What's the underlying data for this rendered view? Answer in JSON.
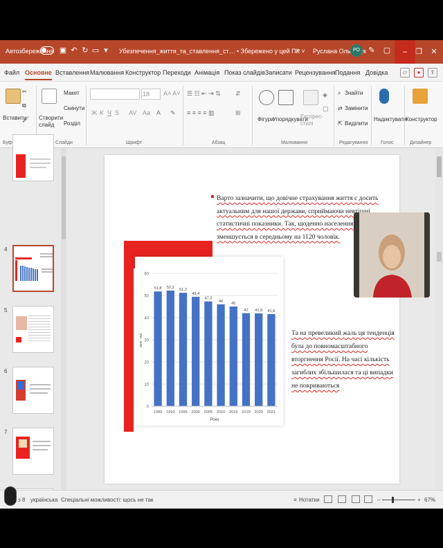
{
  "titlebar": {
    "autosave_label": "Автозбереження",
    "doc_title": "Убезпечення_життя_та_ставлення_студента_до_ризику_ст...",
    "save_status": "• Збережено у цей ПК ˅",
    "user_name": "Руслана Ольльчук",
    "user_initials": "РО"
  },
  "tabs": [
    "Файл",
    "Основне",
    "Вставлення",
    "Малювання",
    "Конструктор",
    "Переходи",
    "Анімація",
    "Показ слайдів",
    "Записати",
    "Рецензування",
    "Подання",
    "Довідка"
  ],
  "active_tab": "Основне",
  "ribbon": {
    "clipboard": {
      "paste": "Вставити",
      "label": "Буфер обміну"
    },
    "slides": {
      "new_slide": "Створити слайд",
      "layout": "Макет",
      "reset": "Скинути",
      "section": "Розділ",
      "label": "Слайди"
    },
    "font": {
      "size": "18",
      "label": "Шрифт",
      "bold": "Ж",
      "italic": "К",
      "underline": "Ч",
      "strike": "S",
      "spacing": "AV",
      "case": "Aa"
    },
    "paragraph": {
      "label": "Абзац"
    },
    "drawing": {
      "shapes": "Фігури",
      "arrange": "Упорядкувати",
      "styles": "Експрес-стилі",
      "label": "Малювання"
    },
    "editing": {
      "find": "Знайти",
      "replace": "Замінити",
      "select": "Виділити",
      "label": "Редагування"
    },
    "voice": {
      "dictate": "Надиктувати",
      "label": "Голос"
    },
    "designer": {
      "designer": "Конструктор",
      "label": "Дизайнер"
    }
  },
  "thumbnails": {
    "numbers": [
      "4",
      "5",
      "6",
      "7",
      "8"
    ]
  },
  "slide": {
    "bullet_lines": [
      "Варто зазначити, що довічне страхування життя є досить",
      "актуальним для нашої держави, сприймаючи невтішні",
      "статистичні показники. Так, щоденно населення України",
      "зменшується в середньому на 1120 чоловік."
    ],
    "right_lines": [
      "Та на превеликий жаль ця тенденція",
      "була до повномасштабного",
      "вторгнення Росії. На часі кількість",
      "загиблих збільшилася та ці випадки",
      "не покриваються"
    ]
  },
  "chart_data": {
    "type": "bar",
    "categories": [
      "1990",
      "1993",
      "1995",
      "2000",
      "2005",
      "2010",
      "2015",
      "2019",
      "2020",
      "2021"
    ],
    "values": [
      51.8,
      52.2,
      51.2,
      49.4,
      47.3,
      46,
      45,
      42,
      41.9,
      41.6
    ],
    "value_labels": [
      "51,8",
      "52,2",
      "51,2",
      "49,4",
      "47,3",
      "46",
      "45",
      "42",
      "41,9",
      "41,6"
    ],
    "yticks": [
      "0",
      "10",
      "20",
      "30",
      "40",
      "50",
      "60"
    ],
    "ylim": [
      0,
      60
    ],
    "xlabel": "Роки",
    "ylabel": "млн. чол.",
    "grid": true,
    "bar_color": "#4472c4"
  },
  "status": {
    "slide_info": "з 8",
    "language": "українська",
    "accessibility": "Спеціальні можливості: щось не так",
    "notes": "Нотатки",
    "zoom": "67%"
  },
  "colors": {
    "accent": "#b7472a",
    "slide_red": "#e8231f"
  }
}
